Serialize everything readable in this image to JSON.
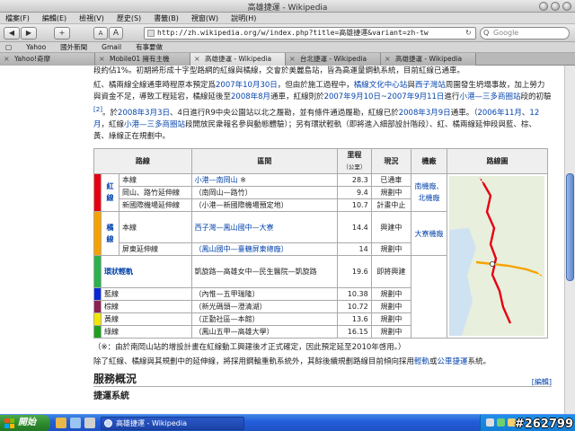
{
  "window": {
    "title": "高雄捷運 - Wikipedia"
  },
  "menu": [
    "檔案(F)",
    "編輯(E)",
    "檢視(V)",
    "歷史(S)",
    "書籤(B)",
    "視窗(W)",
    "說明(H)"
  ],
  "toolbar": {
    "back": "◀",
    "forward": "▶",
    "plus": "+",
    "font_small": "A",
    "font_large": "A",
    "url": "http://zh.wikipedia.org/w/index.php?title=高雄捷運&variant=zh-tw",
    "reload": "↻",
    "search_placeholder": "Google",
    "search_icon": "Q"
  },
  "bookmarks": [
    "▢",
    "Yahoo",
    "國外新聞",
    "Gmail",
    "有事要做"
  ],
  "tabs": [
    {
      "label": "Yahoo!奇摩",
      "active": false
    },
    {
      "label": "Mobile01 擁有主機",
      "active": false
    },
    {
      "label": "高雄捷運 - Wikipedia",
      "active": true
    },
    {
      "label": "台北捷運 - Wikipedia",
      "active": false
    },
    {
      "label": "高雄捷運 - Wikipedia",
      "active": false
    }
  ],
  "article": {
    "p0": "段約佔1%。初期將形成十字型路網的紅線與橘線，交會於美麗島站，皆為高運量鋼軌系統，目前紅線已通車。",
    "p1_a": "紅、橘兩線全線通車時程原本預定爲",
    "p1_link1": "2007年10月30日",
    "p1_b": "，但由於施工過程中，",
    "p1_link2": "橘線文化中心站",
    "p1_c": "與",
    "p1_link3": "西子灣站",
    "p1_d": "周圍發生坍塌事故，加上勞力與資金不足，導致工程延宕，橘線延後至",
    "p1_link4": "2008年8月",
    "p1_e": "通車，紅線則於",
    "p1_link5": "2007年9月10日~2007年9月11日",
    "p1_f": "進行",
    "p1_link6": "小港—三多商圈站",
    "p1_g": "段的初驗",
    "p1_ref": "[2]",
    "p1_h": "。於",
    "p1_link7": "2008年3月3日",
    "p1_i": "、4日進行R9中央公園站以北之履勘，並有條件通過履勘，紅線已於",
    "p1_link8": "2008年3月9日",
    "p1_j": "通車。（",
    "p1_link9": "2006年11月",
    "p1_k": "、",
    "p1_link10": "12月",
    "p1_l": "，紅線",
    "p1_link11": "小港—三多商圈站",
    "p1_m": "段開放民衆報名參與動態體驗）；另有環狀輕軌（即將進入細部設計階段）、紅、橘兩線延伸段與藍、棕、黃、綠線正在規劃中。",
    "table": {
      "headers": [
        "路線",
        "區間",
        "里程",
        "（公里）",
        "現況",
        "機廠",
        "路線圖"
      ],
      "rows": [
        {
          "group": "紅線",
          "sub": "本線",
          "range": "小港—南岡山",
          "mark": " ※",
          "km": "28.3",
          "status": "已通車"
        },
        {
          "group": "",
          "sub": "岡山、路竹延伸線",
          "range": "（南岡山—路竹）",
          "km": "9.4",
          "status": "規劃中"
        },
        {
          "group": "",
          "sub": "新國際機場延伸線",
          "range": "（小港—新國際機場預定地）",
          "km": "10.7",
          "status": "計畫中止"
        },
        {
          "group": "橘線",
          "sub": "本線",
          "range": "西子灣—鳳山國中—大寮",
          "km": "14.4",
          "status": "興建中"
        },
        {
          "group": "",
          "sub": "屏東延伸線",
          "range": "（鳳山國中—臺糖屏東總廠）",
          "km": "14",
          "status": "規劃中"
        },
        {
          "group": "環狀輕軌",
          "sub": "",
          "range": "凱旋路—高雄女中—民生醫院—凱旋路",
          "km": "19.6",
          "status": "即將興建"
        },
        {
          "group": "藍線",
          "sub": "",
          "range": "（內惟—五甲瑞隆）",
          "km": "10.38",
          "status": "規劃中"
        },
        {
          "group": "棕線",
          "sub": "",
          "range": "（新光碼頭—澄清湖）",
          "km": "10.72",
          "status": "規劃中"
        },
        {
          "group": "黃線",
          "sub": "",
          "range": "（正勤社區—本館）",
          "km": "13.6",
          "status": "規劃中"
        },
        {
          "group": "綠線",
          "sub": "",
          "range": "（鳳山五甲—高雄大學）",
          "km": "16.15",
          "status": "規劃中"
        }
      ],
      "depot_red": "南機廠、北機廠",
      "depot_orange": "大寮機廠"
    },
    "note": "（※：由於南岡山站的增設計畫在紅線動工興建後才正式確定，因此預定延至2010年啓用。）",
    "p2_a": "除了紅線、橘線與其規劃中的延伸線，將採用鋼輪重軌系統外，其餘後續規劃路線目前傾向採用",
    "p2_link1": "輕軌",
    "p2_b": "或",
    "p2_link2": "公車捷運",
    "p2_c": "系統。",
    "section": "服務概況",
    "edit": "[編輯]",
    "subsection": "捷運系統"
  },
  "colors": {
    "red": "#e60012",
    "orange": "#f5a200",
    "light_green": "#2bb24c",
    "blue": "#0a28d8",
    "brown": "#8b2252",
    "yellow": "#f2e600",
    "green": "#1ea01e"
  },
  "taskbar": {
    "start": "開始",
    "task": "高雄捷運 - Wikipedia",
    "watermark": "#262799"
  }
}
